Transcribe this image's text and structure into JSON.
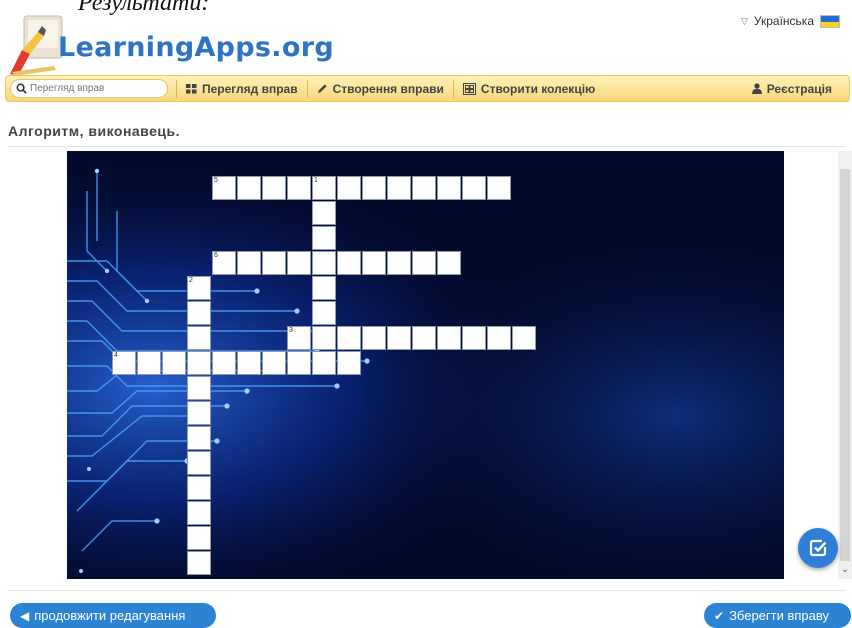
{
  "document_fragment": "Результати:",
  "site": {
    "logo_text": "LearningApps.org"
  },
  "language": {
    "label": "Українська",
    "flag_colors": [
      "#1e6fd0",
      "#f7d21f"
    ]
  },
  "navbar": {
    "search_placeholder": "Перегляд вправ",
    "items": [
      {
        "icon": "grid-icon",
        "label": "Перегляд вправ"
      },
      {
        "icon": "pencil-icon",
        "label": "Створення вправи"
      },
      {
        "icon": "collection-icon",
        "label": "Створити колекцію"
      }
    ],
    "register": {
      "icon": "user-icon",
      "label": "Реєстрація"
    },
    "accent_color": "#f7d77a"
  },
  "exercise": {
    "title": "Алгоритм, виконавець.",
    "background": "blue circuit board",
    "crossword": {
      "words": [
        {
          "number": "1",
          "direction": "down",
          "length": 7
        },
        {
          "number": "2",
          "direction": "down",
          "length": 12
        },
        {
          "number": "3",
          "direction": "across",
          "length": 10
        },
        {
          "number": "4",
          "direction": "across",
          "length": 10
        },
        {
          "number": "5",
          "direction": "across",
          "length": 12
        },
        {
          "number": "6",
          "direction": "across",
          "length": 10
        }
      ]
    }
  },
  "buttons": {
    "continue_label": "продовжити редагування",
    "save_label": "Зберегти вправу",
    "primary_color": "#2c83d3"
  }
}
